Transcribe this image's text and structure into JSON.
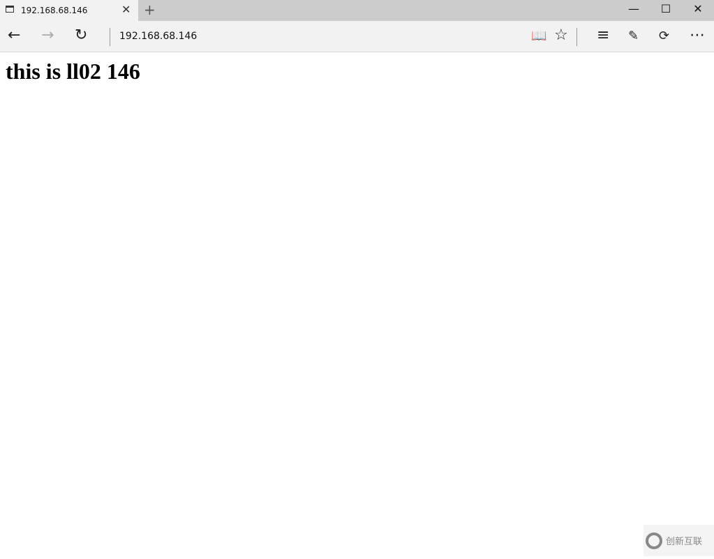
{
  "tab": {
    "title": "192.168.68.146"
  },
  "address_bar": {
    "url": "192.168.68.146"
  },
  "page": {
    "heading": "this is ll02 146"
  },
  "watermark": {
    "logo_text": "创新互联"
  }
}
